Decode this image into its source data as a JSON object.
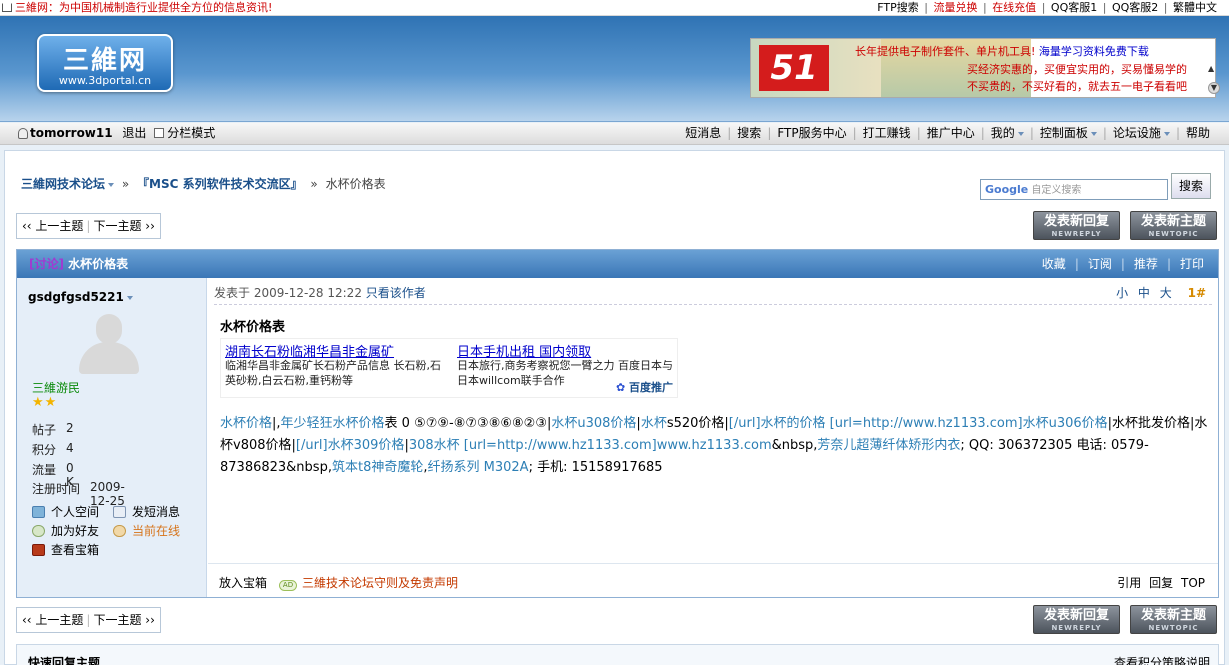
{
  "topbar": {
    "slogan": "三維网：为中国机械制造行业提供全方位的信息资讯!",
    "ftp_search": "FTP搜索",
    "flow_exchange": "流量兑换",
    "online_recharge": "在线充值",
    "qq1": "QQ客服1",
    "qq2": "QQ客服2",
    "traditional": "繁體中文",
    "sep": "|"
  },
  "header": {
    "logo_text": "三維网",
    "logo_url": "www.3dportal.cn",
    "banner": {
      "big": "51",
      "line1_red": "长年提供电子制作套件、单片机工具!",
      "line1_blue": "海量学习资料免费下载",
      "line2": "买经济实惠的，买便宜实用的，买易懂易学的",
      "line3": "不买贵的，不买好看的，就去五一电子看看吧"
    }
  },
  "usernav": {
    "username": "tomorrow11",
    "logout": "退出",
    "split_mode": "分栏模式",
    "items": [
      {
        "label": "短消息",
        "dd": false
      },
      {
        "label": "搜索",
        "dd": false
      },
      {
        "label": "FTP服务中心",
        "dd": false
      },
      {
        "label": "打工赚钱",
        "dd": false
      },
      {
        "label": "推广中心",
        "dd": false
      },
      {
        "label": "我的",
        "dd": true
      },
      {
        "label": "控制面板",
        "dd": true
      },
      {
        "label": "论坛设施",
        "dd": true
      },
      {
        "label": "帮助",
        "dd": false
      }
    ]
  },
  "breadcrumb": {
    "forum": "三維网技术论坛",
    "board": "『MSC 系列软件技术交流区』",
    "sep": "»",
    "current": "水杯价格表"
  },
  "search": {
    "google": "Google",
    "placeholder": "自定义搜索",
    "button": "搜索"
  },
  "pager": {
    "prev": "‹‹ 上一主题",
    "next": "下一主题 ››",
    "sep": "|"
  },
  "buttons": {
    "reply": "发表新回复",
    "reply_sub": "NEWREPLY",
    "newtopic": "发表新主题",
    "newtopic_sub": "NEWTOPIC"
  },
  "thread": {
    "tag": "[讨论]",
    "title": "水杯价格表",
    "actions": [
      "收藏",
      "订阅",
      "推荐",
      "打印"
    ]
  },
  "author": {
    "name": "gsdgfgsd5221",
    "rank": "三維游民",
    "stars": "★★",
    "stats": [
      {
        "label": "帖子",
        "value": "2"
      },
      {
        "label": "积分",
        "value": "4"
      },
      {
        "label": "流量",
        "value": "0 K"
      }
    ],
    "reg_label": "注册时间",
    "reg_value": "2009-12-25",
    "links": {
      "space": "个人空间",
      "pm": "发短消息",
      "friend": "加为好友",
      "online": "当前在线",
      "treasure": "查看宝箱"
    }
  },
  "post": {
    "posted_at": "发表于  2009-12-28 12:22",
    "author_only": "只看该作者",
    "font_small": "小",
    "font_mid": "中",
    "font_big": "大",
    "floor": "1#",
    "heading": "水杯价格表",
    "ad": {
      "title1": "湖南长石粉临湘华昌非金属矿",
      "desc1": "临湘华昌非金属矿长石粉产品信息 长石粉,石英砂粉,白云石粉,重钙粉等",
      "title2": "日本手机出租 国内领取",
      "desc2": "日本旅行,商务考察祝您一臂之力  百度日本与日本willcom联手合作",
      "baidu": "百度推广"
    },
    "body": {
      "p1": "水杯价格",
      "p2": "|,",
      "p3": "年少轻狂水杯价格",
      "p4": "表 0 ⑤⑦⑨-⑧⑦③⑧⑥⑧②③|",
      "p5": "水杯u308价格",
      "p6": "|",
      "p7": "水杯",
      "p8": "s520价格|",
      "p9": "[/url]水杯的价格",
      "p10": "  [url=http://www.hz1133.com]水杯u306价格",
      "p11": "|水杯批发价格|水杯v808价格|",
      "p12": "[/url]水杯309价格",
      "p13": "|",
      "p14": "308水杯",
      "p15": "  [url=http://www.hz1133.com]www.hz1133.com",
      "p16": "&nbsp,",
      "p17": "芳奈儿超薄纤体矫形内衣",
      "p18": "; QQ: 306372305 电话: 0579-87386823&nbsp,",
      "p19": "筑本t8神奇魔轮",
      "p20": ",",
      "p21": "纤扬系列",
      "p22": "  M302A",
      "p23": "; 手机: 15158917685"
    },
    "footer": {
      "treasure": "放入宝箱",
      "ad_badge": "AD",
      "rules": "三維技术论坛守则及免责声明",
      "quote": "引用",
      "reply": "回复",
      "top": "TOP"
    }
  },
  "quick_reply": {
    "title": "快速回复主题",
    "policy": "查看积分策略说明"
  }
}
